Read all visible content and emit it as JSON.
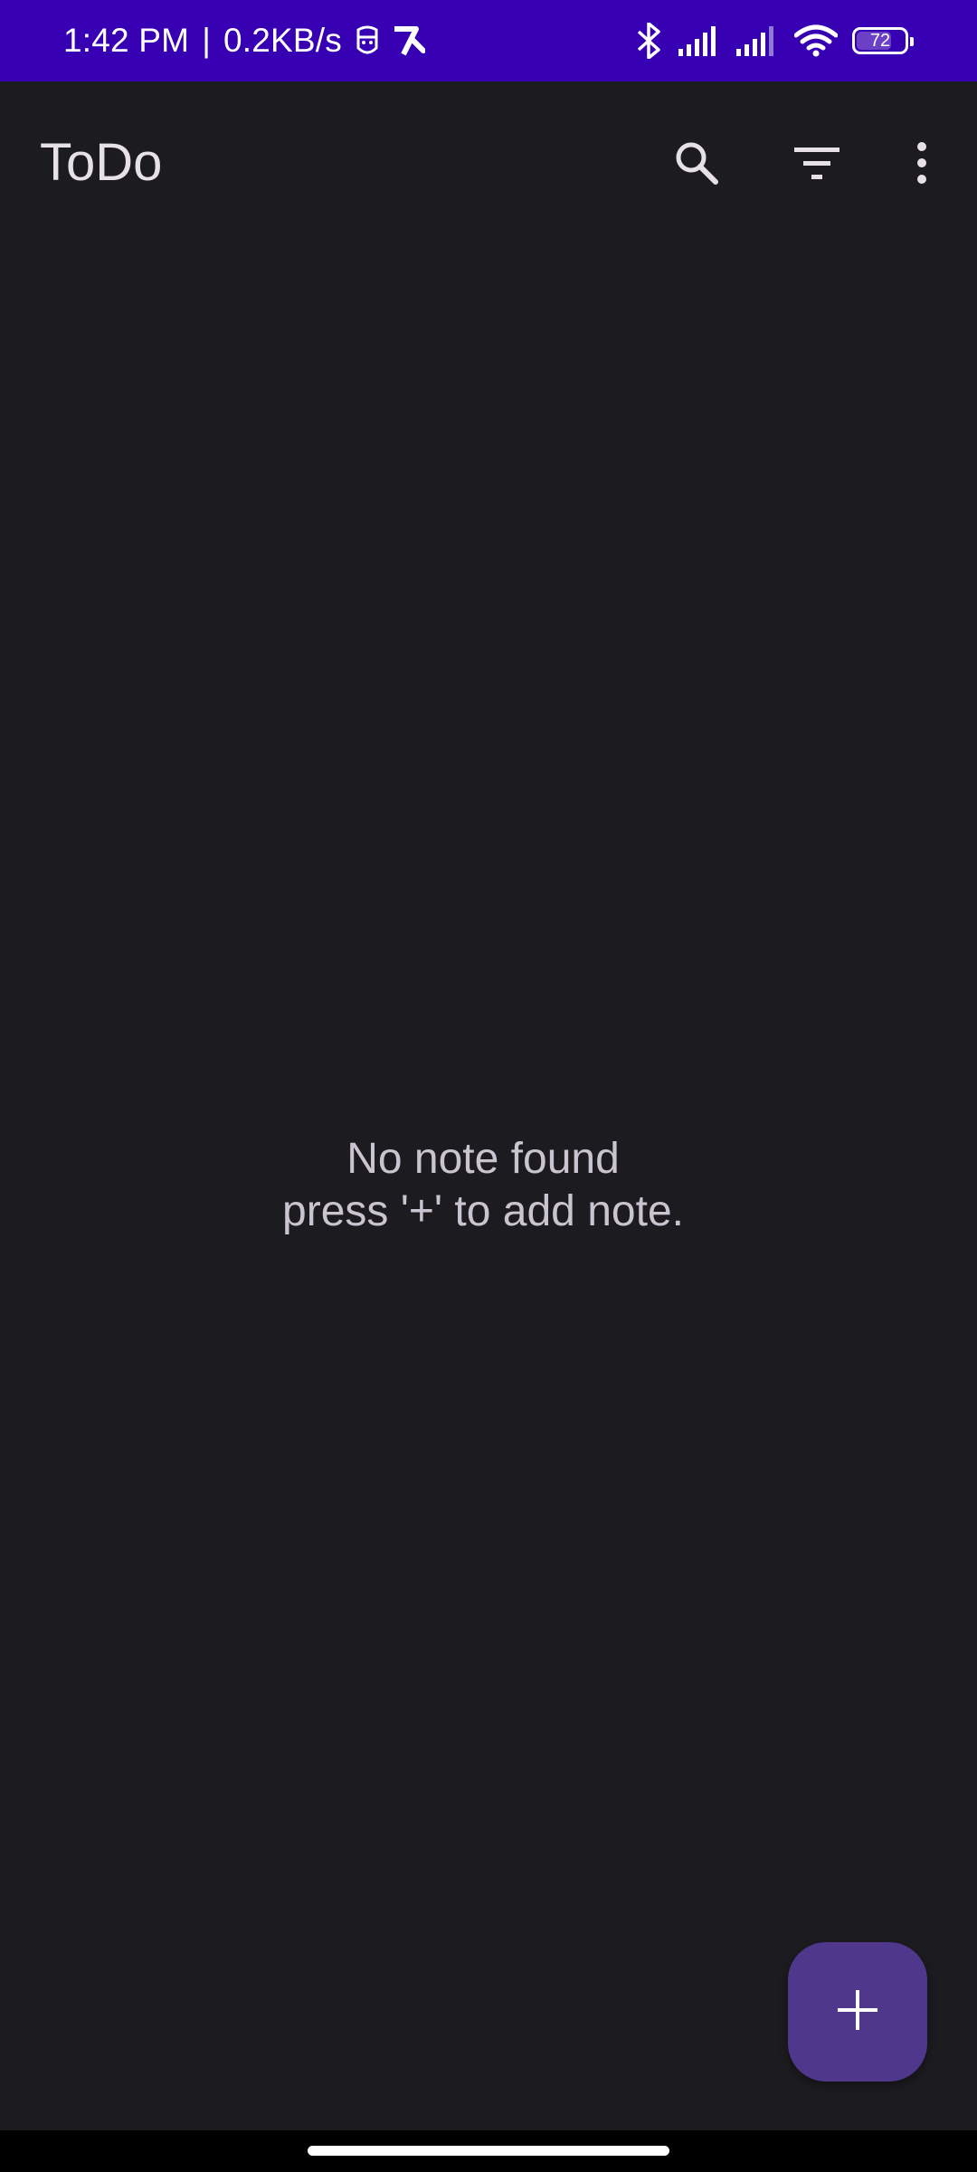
{
  "status_bar": {
    "time": "1:42 PM",
    "separator": "|",
    "network_speed": "0.2KB/s",
    "battery_level": "72",
    "icons": [
      "face-icon",
      "app-notification-icon",
      "bluetooth-icon",
      "signal-icon",
      "signal-icon",
      "wifi-icon",
      "battery-icon"
    ]
  },
  "app_bar": {
    "title": "ToDo",
    "actions": [
      "search-icon",
      "filter-icon",
      "more-options-icon"
    ]
  },
  "empty_state": {
    "line1": "No note found",
    "line2": "press '+' to add note."
  },
  "fab": {
    "icon": "plus-icon"
  },
  "colors": {
    "status_bar": "#3700b3",
    "background": "#1c1b1f",
    "fab": "#4f378b",
    "text_primary": "#e6e1e5",
    "text_secondary": "#cac4d0"
  }
}
